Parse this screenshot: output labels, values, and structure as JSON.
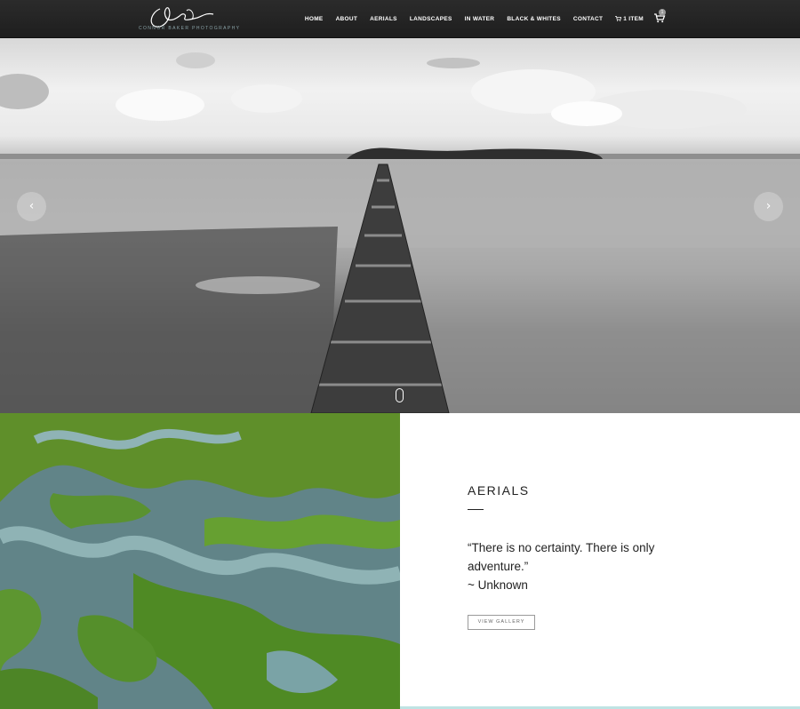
{
  "header": {
    "logo_sub": "CONNOR BAKER PHOTOGRAPHY",
    "nav": [
      "HOME",
      "ABOUT",
      "AERIALS",
      "LANDSCAPES",
      "IN WATER",
      "BLACK & WHITES",
      "CONTACT"
    ],
    "cart_label": "1 ITEM",
    "cart_count": "1"
  },
  "hero": {
    "prev_icon": "chevron-left-icon",
    "next_icon": "chevron-right-icon",
    "prev_glyph": "‹",
    "next_glyph": "›"
  },
  "aerials": {
    "title": "AERIALS",
    "quote": "“There is no certainty. There is only adventure.”",
    "author": "~ Unknown",
    "button_label": "VIEW GALLERY"
  },
  "colors": {
    "header_bg": "#222222",
    "accent_line": "#bfe3e3",
    "marsh_green": "#5b8f2a",
    "water_blue": "#7a9ea3"
  }
}
